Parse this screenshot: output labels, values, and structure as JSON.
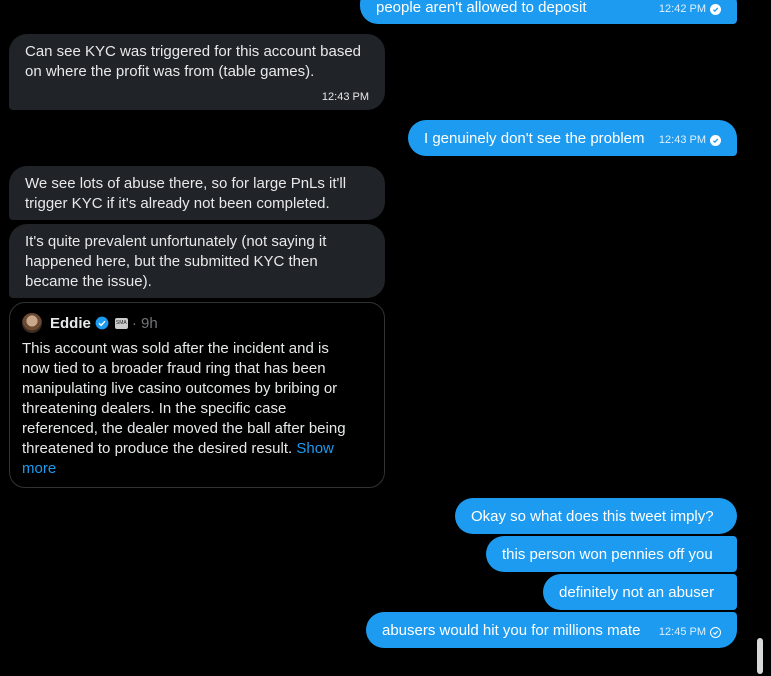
{
  "messages": [
    {
      "id": "m1",
      "side": "sent",
      "text": "people aren't allowed to deposit",
      "time": "12:42 PM",
      "read": true
    },
    {
      "id": "m2",
      "side": "recv",
      "lines": [
        "Can see KYC was triggered for this account based",
        "on where the profit was from (table games)."
      ],
      "time": "12:43 PM"
    },
    {
      "id": "m3",
      "side": "sent",
      "text": "I genuinely don't see the problem",
      "time": "12:43 PM",
      "read": true
    },
    {
      "id": "m4",
      "side": "recv",
      "lines": [
        "We see lots of abuse there, so for large PnLs it'll",
        "trigger KYC if it's already not been completed."
      ]
    },
    {
      "id": "m5",
      "side": "recv",
      "lines": [
        "It's quite prevalent unfortunately (not saying it",
        "happened here, but the submitted KYC then",
        "became the issue)."
      ]
    },
    {
      "id": "m6",
      "side": "sent",
      "text": "Okay so what does this tweet imply?"
    },
    {
      "id": "m7",
      "side": "sent",
      "text": "this person won pennies off you"
    },
    {
      "id": "m8",
      "side": "sent",
      "text": "definitely not an abuser"
    },
    {
      "id": "m9",
      "side": "sent",
      "text": "abusers would hit you for millions mate",
      "time": "12:45 PM",
      "read": false
    }
  ],
  "quoted_tweet": {
    "author": "Eddie",
    "affiliate_badge": "SMA",
    "age": "· 9h",
    "lines": [
      "This account was sold after the incident and is",
      "now tied to a broader fraud ring that has been",
      "manipulating live casino outcomes by bribing or",
      "threatening dealers. In the specific case",
      "referenced, the dealer moved the ball after being",
      "threatened to produce the desired result."
    ],
    "show_more_1": "Show",
    "show_more_2": "more"
  },
  "colors": {
    "sent": "#1d9bf0",
    "received": "#202327",
    "background": "#000000",
    "muted": "#71767b"
  },
  "icons": {
    "read_receipt": "check-circle-icon",
    "verified": "verified-badge-icon"
  }
}
